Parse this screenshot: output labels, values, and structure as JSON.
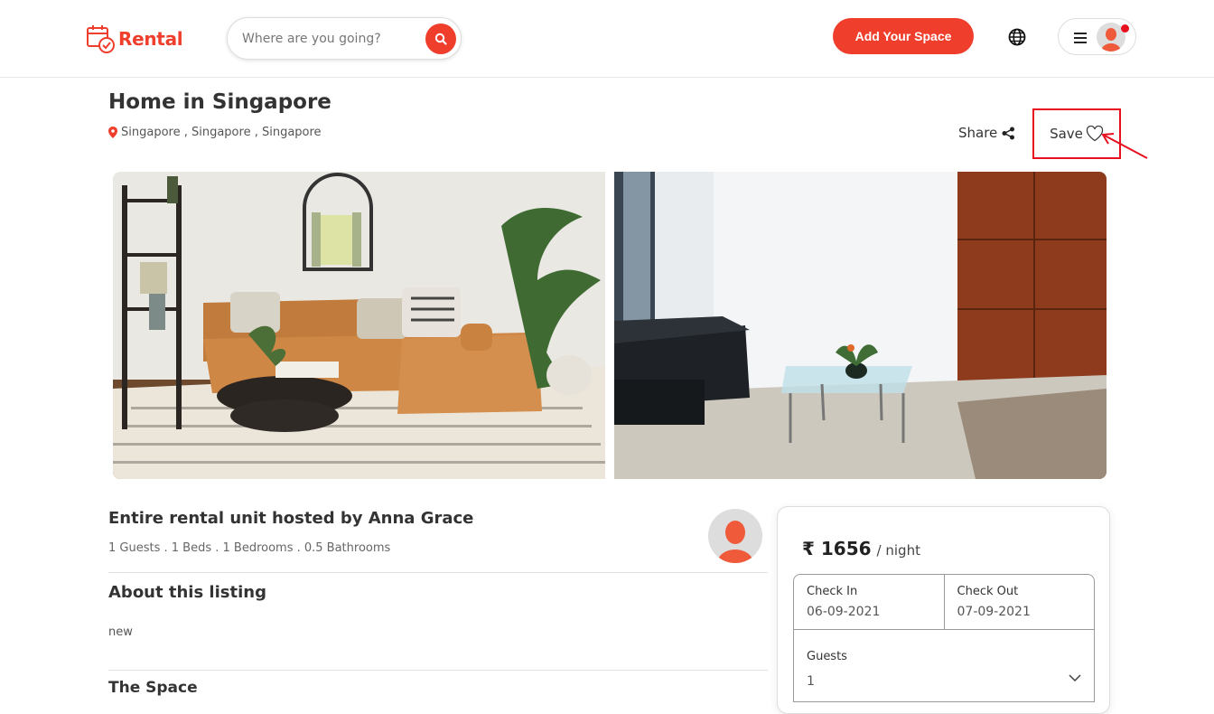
{
  "header": {
    "logo_text": "Rental",
    "search_placeholder": "Where are you going?",
    "add_space_label": "Add Your Space",
    "brand_color": "#ef3e2c"
  },
  "listing": {
    "title": "Home in Singapore",
    "location": "Singapore , Singapore , Singapore",
    "share_label": "Share",
    "save_label": "Save"
  },
  "photos": [
    {
      "alt": "Living room with orange leather sofa"
    },
    {
      "alt": "Modern room with black leather sofa"
    }
  ],
  "host": {
    "title": "Entire rental unit hosted by Anna Grace",
    "details": "1 Guests . 1 Beds . 1 Bedrooms . 0.5 Bathrooms"
  },
  "about": {
    "title": "About this listing",
    "text": "new"
  },
  "space": {
    "title": "The Space"
  },
  "booking": {
    "currency": "₹",
    "price": "₹ 1656",
    "unit": "/ night",
    "check_in_label": "Check In",
    "check_in_value": "06-09-2021",
    "check_out_label": "Check Out",
    "check_out_value": "07-09-2021",
    "guests_label": "Guests",
    "guests_value": "1"
  }
}
